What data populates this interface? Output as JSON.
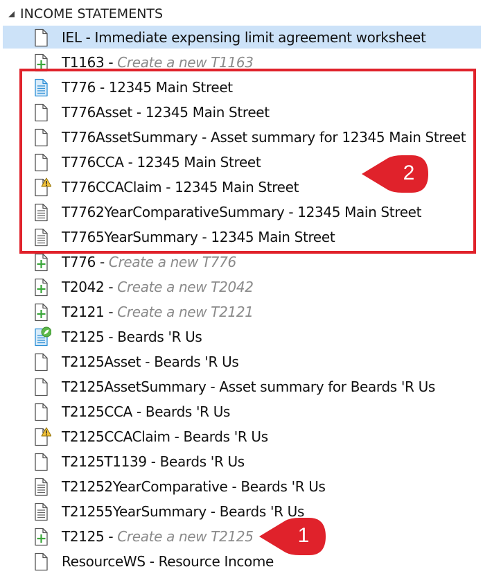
{
  "group": {
    "title": "INCOME STATEMENTS",
    "expander_icon": "triangle-expanded-icon"
  },
  "items": [
    {
      "name": "IEL",
      "sep": " - ",
      "desc": "Immediate expensing limit agreement worksheet",
      "create": false,
      "icon": "document-icon",
      "selected": true
    },
    {
      "name": "T1163",
      "sep": " - ",
      "desc": "Create a new T1163",
      "create": true,
      "icon": "document-add-icon"
    },
    {
      "name": "T776",
      "sep": " - ",
      "desc": "12345 Main Street",
      "create": false,
      "icon": "document-lines-blue-icon"
    },
    {
      "name": "T776Asset",
      "sep": " - ",
      "desc": "12345 Main Street",
      "create": false,
      "icon": "document-icon"
    },
    {
      "name": "T776AssetSummary",
      "sep": " - ",
      "desc": "Asset summary for 12345 Main Street",
      "create": false,
      "icon": "document-icon"
    },
    {
      "name": "T776CCA",
      "sep": " - ",
      "desc": "12345 Main Street",
      "create": false,
      "icon": "document-icon"
    },
    {
      "name": "T776CCAClaim",
      "sep": " - ",
      "desc": "12345 Main Street",
      "create": false,
      "icon": "document-warning-icon"
    },
    {
      "name": "T7762YearComparativeSummary",
      "sep": " - ",
      "desc": "12345 Main Street",
      "create": false,
      "icon": "document-lines-icon"
    },
    {
      "name": "T7765YearSummary",
      "sep": " - ",
      "desc": "12345 Main Street",
      "create": false,
      "icon": "document-lines-icon"
    },
    {
      "name": "T776",
      "sep": " - ",
      "desc": "Create a new T776",
      "create": true,
      "icon": "document-add-icon"
    },
    {
      "name": "T2042",
      "sep": " - ",
      "desc": "Create a new T2042",
      "create": true,
      "icon": "document-add-icon"
    },
    {
      "name": "T2121",
      "sep": " - ",
      "desc": "Create a new T2121",
      "create": true,
      "icon": "document-add-icon"
    },
    {
      "name": "T2125",
      "sep": " - ",
      "desc": "Beards 'R Us",
      "create": false,
      "icon": "document-lines-blue-leaf-icon"
    },
    {
      "name": "T2125Asset",
      "sep": " - ",
      "desc": "Beards 'R Us",
      "create": false,
      "icon": "document-icon"
    },
    {
      "name": "T2125AssetSummary",
      "sep": " - ",
      "desc": "Asset summary for Beards 'R Us",
      "create": false,
      "icon": "document-icon"
    },
    {
      "name": "T2125CCA",
      "sep": " - ",
      "desc": "Beards 'R Us",
      "create": false,
      "icon": "document-icon"
    },
    {
      "name": "T2125CCAClaim",
      "sep": " - ",
      "desc": "Beards 'R Us",
      "create": false,
      "icon": "document-warning-icon"
    },
    {
      "name": "T2125T1139",
      "sep": " - ",
      "desc": "Beards 'R Us",
      "create": false,
      "icon": "document-icon"
    },
    {
      "name": "T21252YearComparative",
      "sep": " - ",
      "desc": "Beards 'R Us",
      "create": false,
      "icon": "document-lines-icon"
    },
    {
      "name": "T21255YearSummary",
      "sep": " - ",
      "desc": "Beards 'R Us",
      "create": false,
      "icon": "document-lines-icon"
    },
    {
      "name": "T2125",
      "sep": " - ",
      "desc": "Create a new T2125",
      "create": true,
      "icon": "document-add-icon"
    },
    {
      "name": "ResourceWS",
      "sep": " - ",
      "desc": "Resource Income",
      "create": false,
      "icon": "document-icon"
    }
  ],
  "callouts": [
    {
      "number": "1",
      "target": "T2125 - Create a new T2125"
    },
    {
      "number": "2",
      "target": "T776 group"
    }
  ],
  "colors": {
    "selection": "#cce2f8",
    "callout_red": "#e0222b",
    "create_text": "#8a8a8a",
    "add_green": "#3aa63a",
    "doc_blue": "#2d8fd6",
    "warning_yellow": "#f2c23a"
  }
}
